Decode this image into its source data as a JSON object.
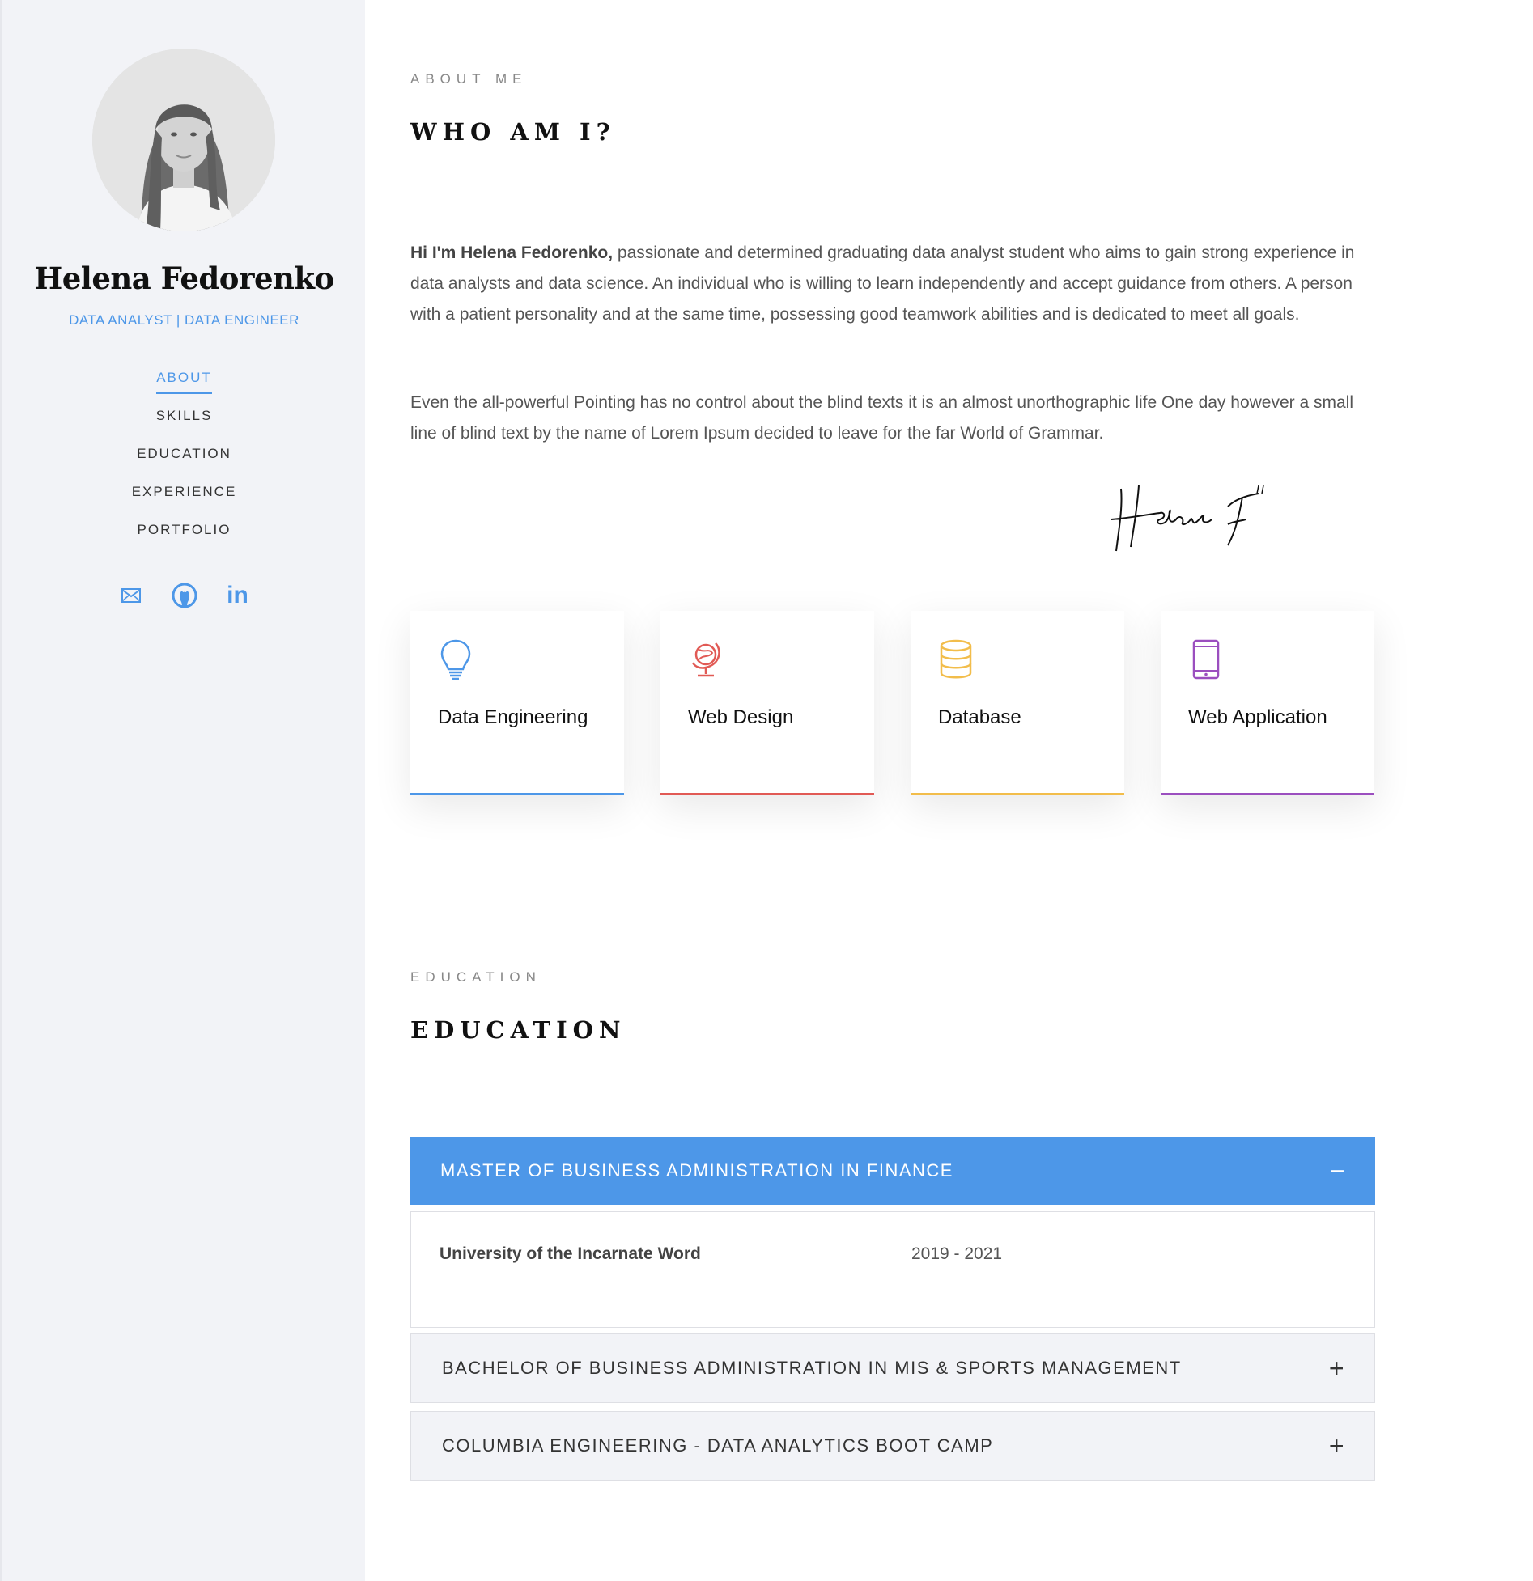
{
  "sidebar": {
    "name": "Helena Fedorenko",
    "role": "DATA ANALYST | DATA ENGINEER",
    "nav": [
      {
        "label": "ABOUT",
        "active": true
      },
      {
        "label": "SKILLS",
        "active": false
      },
      {
        "label": "EDUCATION",
        "active": false
      },
      {
        "label": "EXPERIENCE",
        "active": false
      },
      {
        "label": "PORTFOLIO",
        "active": false
      }
    ],
    "socials": [
      "mail-icon",
      "github-icon",
      "linkedin-icon"
    ],
    "social_linkedin_text": "in"
  },
  "about": {
    "eyebrow": "ABOUT ME",
    "heading": "WHO AM I?",
    "intro_bold": "Hi I'm Helena Fedorenko,",
    "intro_rest": " passionate and determined graduating data analyst student who aims to gain strong experience in data analysts and data science. An individual who is willing to learn independently and accept guidance from others. A person with a patient personality and at the same time, possessing good teamwork abilities and is dedicated to meet all goals.",
    "para2": "Even the all-powerful Pointing has no control about the blind texts it is an almost unorthographic life One day however a small line of blind text by the name of Lorem Ipsum decided to leave for the far World of Grammar.",
    "signature": "Helena F"
  },
  "services": [
    {
      "label": "Data Engineering",
      "icon": "lightbulb-icon",
      "color": "#4d97e8"
    },
    {
      "label": "Web Design",
      "icon": "globe-icon",
      "color": "#e15a55"
    },
    {
      "label": "Database",
      "icon": "database-icon",
      "color": "#f2bd4b"
    },
    {
      "label": "Web Application",
      "icon": "tablet-icon",
      "color": "#9b4fbf"
    }
  ],
  "education": {
    "eyebrow": "EDUCATION",
    "heading": "EDUCATION",
    "items": [
      {
        "title": "MASTER OF BUSINESS ADMINISTRATION IN FINANCE",
        "toggle": "−",
        "expanded": true,
        "school": "University of the Incarnate Word",
        "years": "2019 - 2021"
      },
      {
        "title": "BACHELOR OF BUSINESS ADMINISTRATION IN MIS & SPORTS MANAGEMENT",
        "toggle": "+",
        "expanded": false
      },
      {
        "title": "COLUMBIA ENGINEERING - DATA ANALYTICS BOOT CAMP",
        "toggle": "+",
        "expanded": false
      }
    ]
  },
  "colors": {
    "accent": "#4d97e8",
    "sidebar_bg": "#f2f3f7"
  }
}
